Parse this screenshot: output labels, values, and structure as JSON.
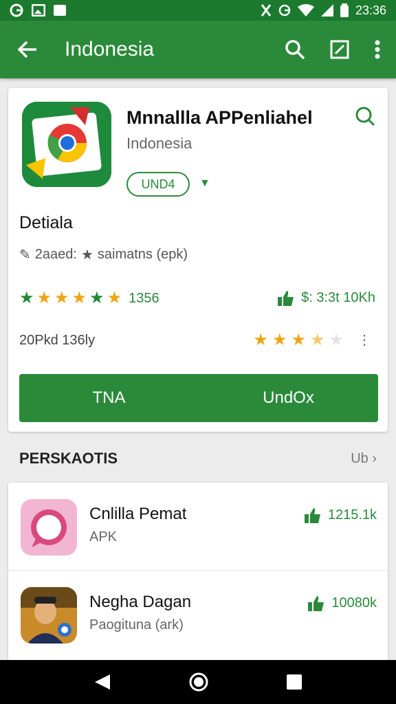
{
  "status_bar": {
    "time": "23:36",
    "icons": [
      "g-icon",
      "image-icon",
      "square-icon",
      "vibrate-icon",
      "g-icon",
      "wifi-icon",
      "signal-icon",
      "battery-icon"
    ]
  },
  "app_bar": {
    "title": "Indonesia"
  },
  "app": {
    "name": "Mnnallla APPenliahel",
    "publisher": "Indonesia",
    "update_label": "UND4",
    "details_title": "Detiala",
    "details_sub_a": "2aaed:",
    "details_sub_b": "saimatns (epk)",
    "rating_count": "1356",
    "likes": "$: 3:3t 10Kh",
    "size": "20Pkd 136ly",
    "btn_left": "TNA",
    "btn_right": "UndOx"
  },
  "section": {
    "title": "PERSKAOTIS",
    "more": "Ub"
  },
  "list": [
    {
      "name": "Cnlilla Pemat",
      "sub": "APK",
      "count": "1215.1k"
    },
    {
      "name": "Negha Dagan",
      "sub": "Paogituna (ark)",
      "count": "10080k"
    }
  ],
  "colors": {
    "primary": "#2a8a3a",
    "status": "#1b7a2e",
    "star_orange": "#f2a311"
  }
}
